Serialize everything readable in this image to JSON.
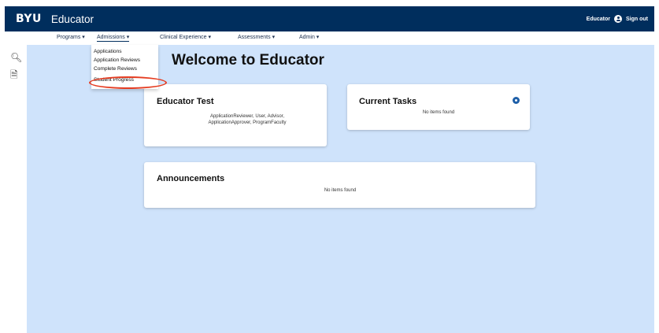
{
  "header": {
    "brand": "BYU",
    "app_title": "Educator",
    "user_label": "Educator",
    "signout_label": "Sign out"
  },
  "nav": {
    "items": [
      {
        "label": "Programs ▾"
      },
      {
        "label": "Admissions ▾"
      },
      {
        "label": "Clinical Experience ▾"
      },
      {
        "label": "Assessments ▾"
      },
      {
        "label": "Admin ▾"
      }
    ]
  },
  "dropdown": {
    "items": [
      {
        "label": "Applications"
      },
      {
        "label": "Application Reviews"
      },
      {
        "label": "Complete Reviews"
      },
      {
        "label": "Student Progress"
      }
    ]
  },
  "main": {
    "welcome": "Welcome to Educator",
    "cards": {
      "educator_test": {
        "title": "Educator Test",
        "roles_line1": "ApplicationReviewer, User, Advisor,",
        "roles_line2": "ApplicationApprover, ProgramFaculty"
      },
      "current_tasks": {
        "title": "Current Tasks",
        "empty": "No items found"
      },
      "announcements": {
        "title": "Announcements",
        "empty": "No items found"
      }
    }
  },
  "icons": {
    "search": "search-icon",
    "document": "document-icon",
    "user": "user-icon",
    "gear": "gear-icon"
  },
  "colors": {
    "header_bg": "#002e5d",
    "main_bg": "#cfe3fb",
    "highlight": "#e53d22",
    "accent": "#1e5fa8"
  }
}
